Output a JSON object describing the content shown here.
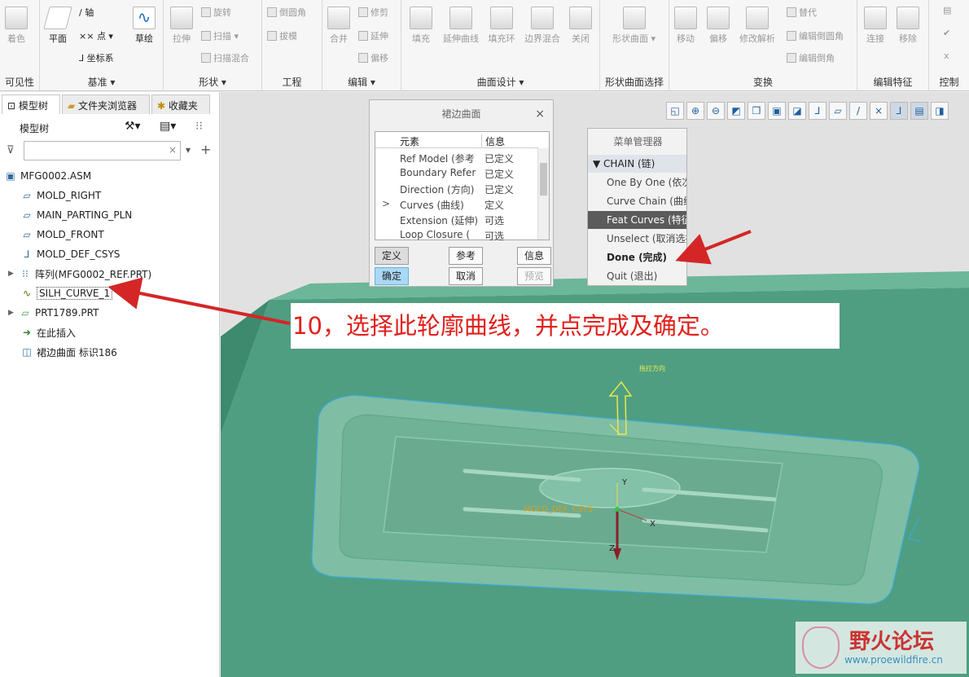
{
  "ribbon": {
    "visibility": {
      "items": [
        "着色"
      ],
      "label": "可见性"
    },
    "datum": {
      "plane": "平面",
      "axis": "轴",
      "point": "点",
      "csys": "坐标系",
      "sketch": "草绘",
      "label": "基准"
    },
    "shapes": {
      "extrude": "拉伸",
      "revolve": "旋转",
      "sweep": "扫描",
      "swept_blend": "扫描混合",
      "label": "形状"
    },
    "engineering": {
      "round": "倒圆角",
      "draft": "拔模",
      "label": "工程"
    },
    "editing": {
      "merge": "合并",
      "trim": "修剪",
      "extend": "延伸",
      "offset": "偏移",
      "label": "编辑"
    },
    "surface_design": {
      "items": [
        "填充",
        "延伸曲线",
        "填充环",
        "边界混合",
        "关闭"
      ],
      "label": "曲面设计"
    },
    "freestyle": {
      "item": "形状曲面",
      "label": "形状曲面选择"
    },
    "transform": {
      "move": "移动",
      "offset": "偏移",
      "modify_analytic": "修改解析",
      "replace": "替代",
      "edit_round": "编辑倒圆角",
      "edit_chamfer": "编辑倒角",
      "label": "变换"
    },
    "edit_features": {
      "attach": "连接",
      "remove": "移除",
      "label": "编辑特征"
    },
    "control": {
      "label": "控制"
    }
  },
  "left_panel": {
    "tabs": [
      "模型树",
      "文件夹浏览器",
      "收藏夹"
    ],
    "tree_title": "模型树",
    "search_placeholder": "",
    "tree_items": [
      "MFG0002.ASM",
      "MOLD_RIGHT",
      "MAIN_PARTING_PLN",
      "MOLD_FRONT",
      "MOLD_DEF_CSYS",
      "阵列(MFG0002_REF.PRT)",
      "SILH_CURVE_1",
      "PRT1789.PRT",
      "在此插入",
      "裙边曲面 标识186"
    ]
  },
  "dialog": {
    "title": "裙边曲面",
    "columns": [
      "元素",
      "信息"
    ],
    "rows": [
      {
        "name": "Ref Model (参考",
        "info": "已定义"
      },
      {
        "name": "Boundary Refer",
        "info": "已定义"
      },
      {
        "name": "Direction (方向)",
        "info": "已定义"
      },
      {
        "name": "Curves (曲线)",
        "info": "定义",
        "current": ">"
      },
      {
        "name": "Extension (延伸)",
        "info": "可选"
      },
      {
        "name": "Loop Closure (",
        "info": "可选"
      }
    ],
    "buttons": {
      "define": "定义",
      "refs": "参考",
      "info": "信息",
      "ok": "确定",
      "cancel": "取消",
      "preview": "预览"
    }
  },
  "menu_manager": {
    "title": "菜单管理器",
    "section": "CHAIN (链)",
    "items": [
      "One By One (依次",
      "Curve Chain (曲线",
      "Feat Curves (特征",
      "Unselect (取消选择",
      "Done (完成)",
      "Quit (退出)"
    ]
  },
  "callout": "10，选择此轮廓曲线，并点完成及确定。",
  "viewport": {
    "pull_direction": "拖拉方向",
    "csys_label": "MOLD_DEF_CSYS",
    "axes": [
      "Y",
      "X",
      "Z"
    ]
  },
  "watermark": {
    "title": "野火论坛",
    "url": "www.proewildfire.cn"
  },
  "colors": {
    "model": "#4f9e82",
    "callout_text": "#e0201c",
    "arrow": "#d42626",
    "selected_menu": "#5b5b5b"
  }
}
